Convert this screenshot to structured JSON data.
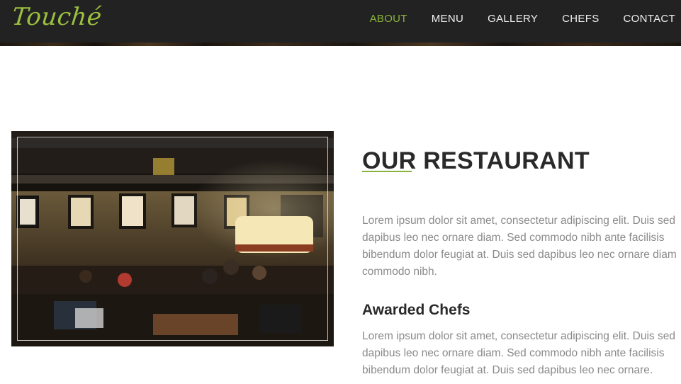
{
  "navbar": {
    "brand": "Touché",
    "links": [
      {
        "label": "ABOUT",
        "active": true
      },
      {
        "label": "MENU",
        "active": false
      },
      {
        "label": "GALLERY",
        "active": false
      },
      {
        "label": "CHEFS",
        "active": false
      },
      {
        "label": "CONTACT",
        "active": false
      }
    ]
  },
  "about": {
    "title": "OUR RESTAURANT",
    "paragraph_1": "Lorem ipsum dolor sit amet, consectetur adipiscing elit. Duis sed dapibus leo nec ornare diam. Sed commodo nibh ante facilisis bibendum dolor feugiat at. Duis sed dapibus leo nec ornare diam commodo nibh.",
    "subheading": "Awarded Chefs",
    "paragraph_2": "Lorem ipsum dolor sit amet, consectetur adipiscing elit. Duis sed dapibus leo nec ornare diam. Sed commodo nibh ante facilisis bibendum dolor feugiat at. Duis sed dapibus leo nec ornare."
  },
  "colors": {
    "accent": "#8ab23c",
    "brand": "#9bbf3f",
    "navbar_bg": "#222222",
    "heading": "#2a2a2a",
    "body_text": "#8a8a8a"
  }
}
